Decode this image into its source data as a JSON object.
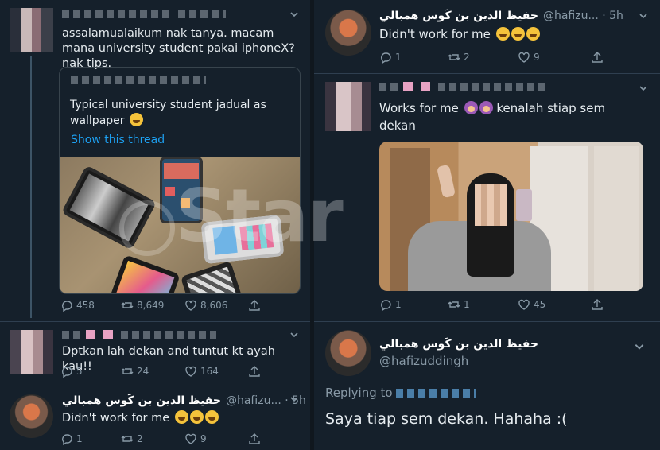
{
  "left": {
    "tweet1": {
      "text": "assalamualaikum nak tanya. macam mana university student pakai iphoneX? nak tips.",
      "quote": {
        "text": "Typical university student jadual as wallpaper",
        "link": "Show this thread"
      },
      "replies": "458",
      "retweets": "8,649",
      "likes": "8,606"
    },
    "tweet2": {
      "text": "Dptkan lah dekan and tuntut kt ayah kau!!",
      "replies": "5",
      "retweets": "24",
      "likes": "164"
    },
    "tweet3": {
      "name": "حفيظ الدين بن كَوس همبالي",
      "handle": "@hafizu... · 5h",
      "text": "Didn't work for me",
      "replies": "1",
      "retweets": "2",
      "likes": "9"
    }
  },
  "right": {
    "tweet1": {
      "name": "حفيظ الدين بن كَوس همبالي",
      "handle": "@hafizu... · 5h",
      "text": "Didn't work for me",
      "replies": "1",
      "retweets": "2",
      "likes": "9"
    },
    "tweet2": {
      "text_a": "Works for me",
      "text_b": "kenalah stiap sem dekan",
      "replies": "1",
      "retweets": "1",
      "likes": "45"
    },
    "tweet3": {
      "name": "حفيظ الدين بن كَوس همبالي",
      "handle": "@hafizuddingh",
      "replying": "Replying to",
      "text": "Saya tiap sem dekan. Hahaha :("
    }
  },
  "watermark": "Star",
  "colors": {
    "background": "#15202b",
    "link": "#1da1f2",
    "muted": "#8899a6"
  }
}
